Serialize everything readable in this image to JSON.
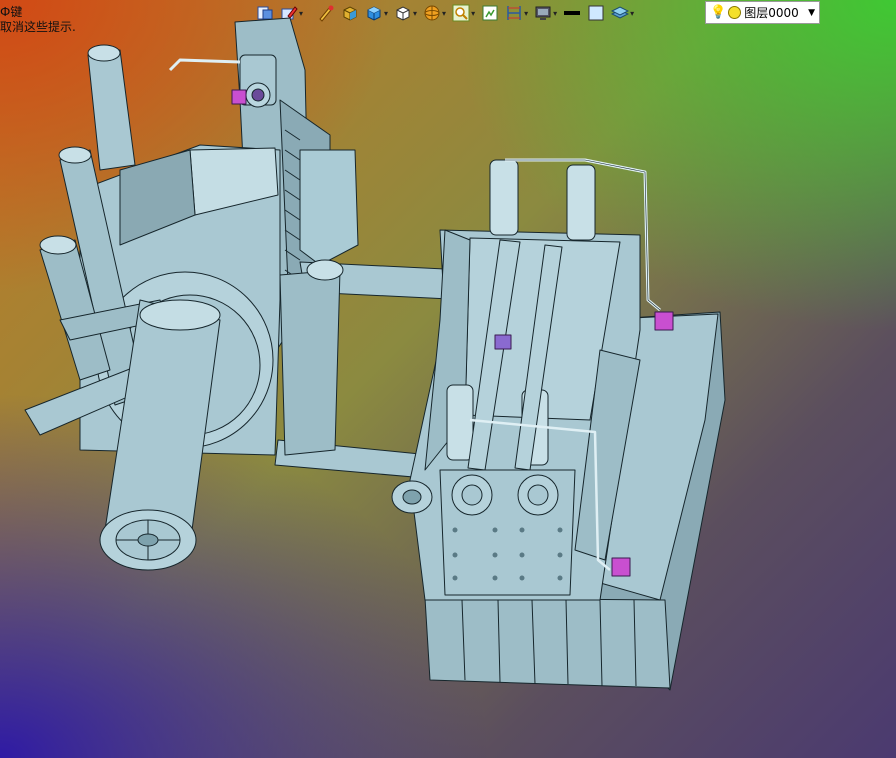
{
  "hint": {
    "line1": "Ф键",
    "line2": "取消这些提示."
  },
  "toolbar": {
    "icons": [
      "view-icon",
      "edit-icon",
      "paint-icon",
      "shaded-box-icon",
      "solid-box-icon",
      "wire-box-icon",
      "sphere-icon",
      "zoom-icon",
      "frame-icon",
      "ruler-icon",
      "monitor-icon",
      "line-weight-icon",
      "color-swatch-icon",
      "layers-icon"
    ],
    "layer_name": "图层0000"
  },
  "colors": {
    "metal": "#a9c8d2",
    "metal_dark": "#7ea2ad",
    "metal_light": "#c8e0e7",
    "outline": "#16262c"
  }
}
